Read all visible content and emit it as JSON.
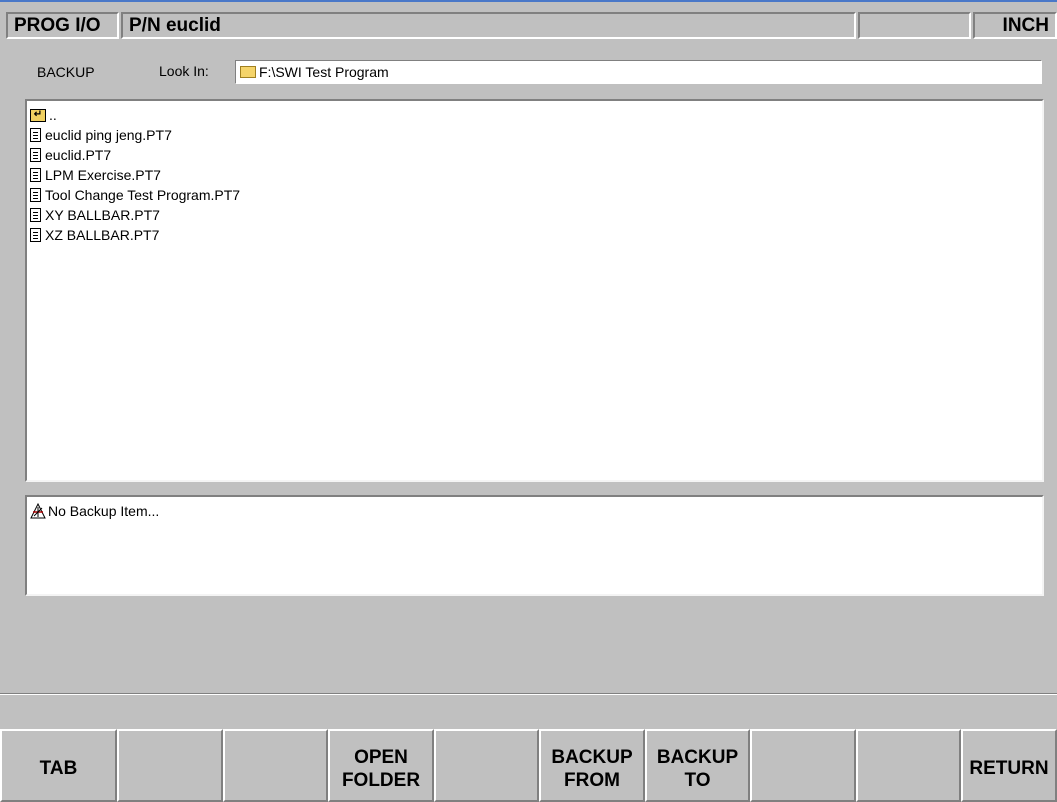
{
  "header": {
    "mode": "PROG I/O",
    "program_name": "P/N euclid",
    "status": "",
    "units": "INCH"
  },
  "browser": {
    "section_label": "BACKUP",
    "look_in_label": "Look In:",
    "look_in_path": "F:\\SWI Test Program",
    "parent_entry": "..",
    "files": [
      "euclid ping jeng.PT7",
      "euclid.PT7",
      "LPM Exercise.PT7",
      "Tool Change Test Program.PT7",
      "XY BALLBAR.PT7",
      "XZ BALLBAR.PT7"
    ]
  },
  "backup_panel": {
    "message": "No Backup Item..."
  },
  "softkeys": [
    {
      "label": "TAB"
    },
    {
      "label": ""
    },
    {
      "label": ""
    },
    {
      "label": "OPEN\nFOLDER"
    },
    {
      "label": ""
    },
    {
      "label": "BACKUP\nFROM"
    },
    {
      "label": "BACKUP\nTO"
    },
    {
      "label": ""
    },
    {
      "label": ""
    },
    {
      "label": "RETURN"
    }
  ],
  "colors": {
    "background": "#c0c0c0",
    "panel": "#ffffff",
    "title_accent": "#4a78c8"
  }
}
